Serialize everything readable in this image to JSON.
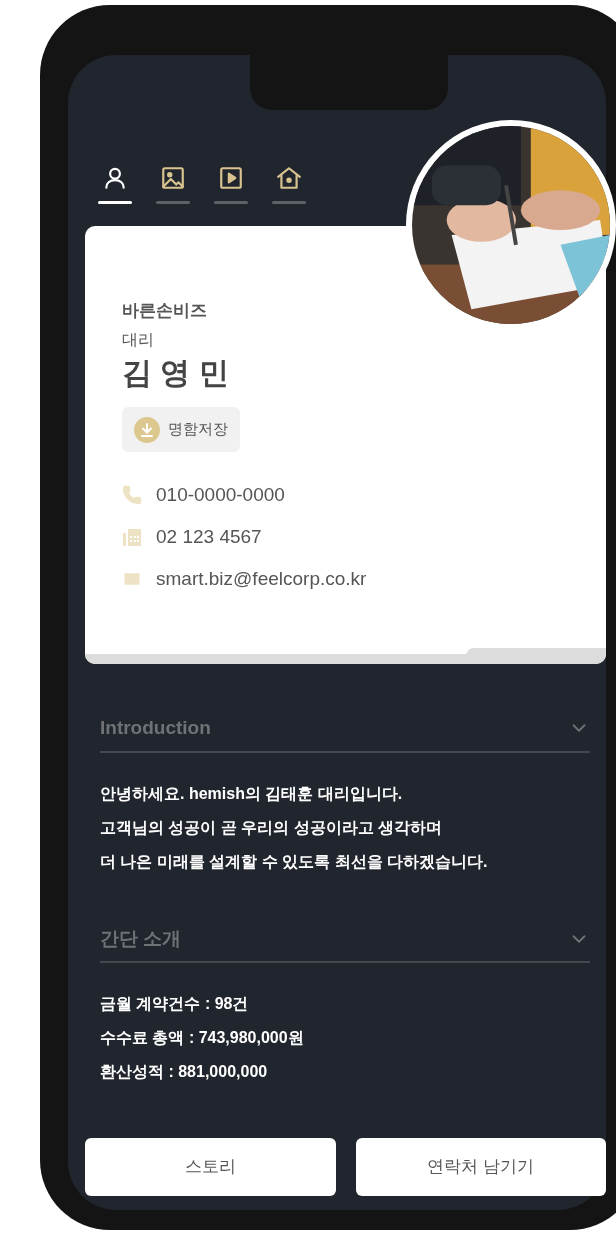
{
  "tabs": [
    {
      "kind": "profile",
      "selected": true
    },
    {
      "kind": "gallery",
      "selected": false
    },
    {
      "kind": "video",
      "selected": false
    },
    {
      "kind": "home",
      "selected": false
    }
  ],
  "card": {
    "company": "바른손비즈",
    "position": "대리",
    "name": "김 영 민",
    "save_button": "명함저장",
    "contacts": [
      {
        "kind": "phone",
        "text": "010-0000-0000"
      },
      {
        "kind": "fax",
        "text": "02 123 4567"
      },
      {
        "kind": "email",
        "text": "smart.biz@feelcorp.co.kr"
      }
    ]
  },
  "sections": [
    {
      "title": "Introduction",
      "expanded": true,
      "lines": [
        "안녕하세요. hemish의 김태훈 대리입니다.",
        "고객님의 성공이 곧 우리의 성공이라고 생각하며",
        "더 나은 미래를 설계할 수 있도록 최선을 다하겠습니다."
      ]
    },
    {
      "title": "간단 소개",
      "expanded": true,
      "lines": [
        "금월 계약건수 : 98건",
        "수수료 총액 : 743,980,000원",
        "환산성적 : 881,000,000"
      ]
    }
  ],
  "buttons": [
    "스토리",
    "연락처 남기기"
  ]
}
